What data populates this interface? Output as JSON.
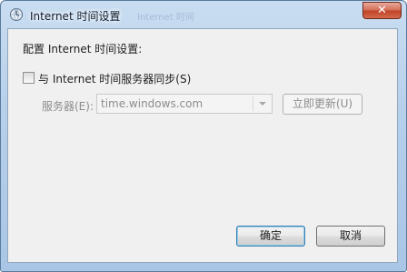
{
  "window": {
    "title": "Internet 时间设置",
    "title_ghost": "Internet 时间",
    "close_glyph": "✕"
  },
  "content": {
    "heading": "配置 Internet 时间设置:",
    "sync_checkbox": {
      "label": "与 Internet 时间服务器同步(S)",
      "checked": false
    },
    "server_label": "服务器(E):",
    "server_value": "time.windows.com",
    "update_button": "立即更新(U)"
  },
  "buttons": {
    "ok": "确定",
    "cancel": "取消"
  },
  "icons": {
    "app": "clock-globe-icon",
    "dropdown": "chevron-down-icon",
    "close": "close-icon"
  },
  "colors": {
    "title_gradient_top": "#c9ddf1",
    "close_red": "#c0432a",
    "disabled_text": "#8d8d8d",
    "client_bg": "#f0f0f0"
  }
}
